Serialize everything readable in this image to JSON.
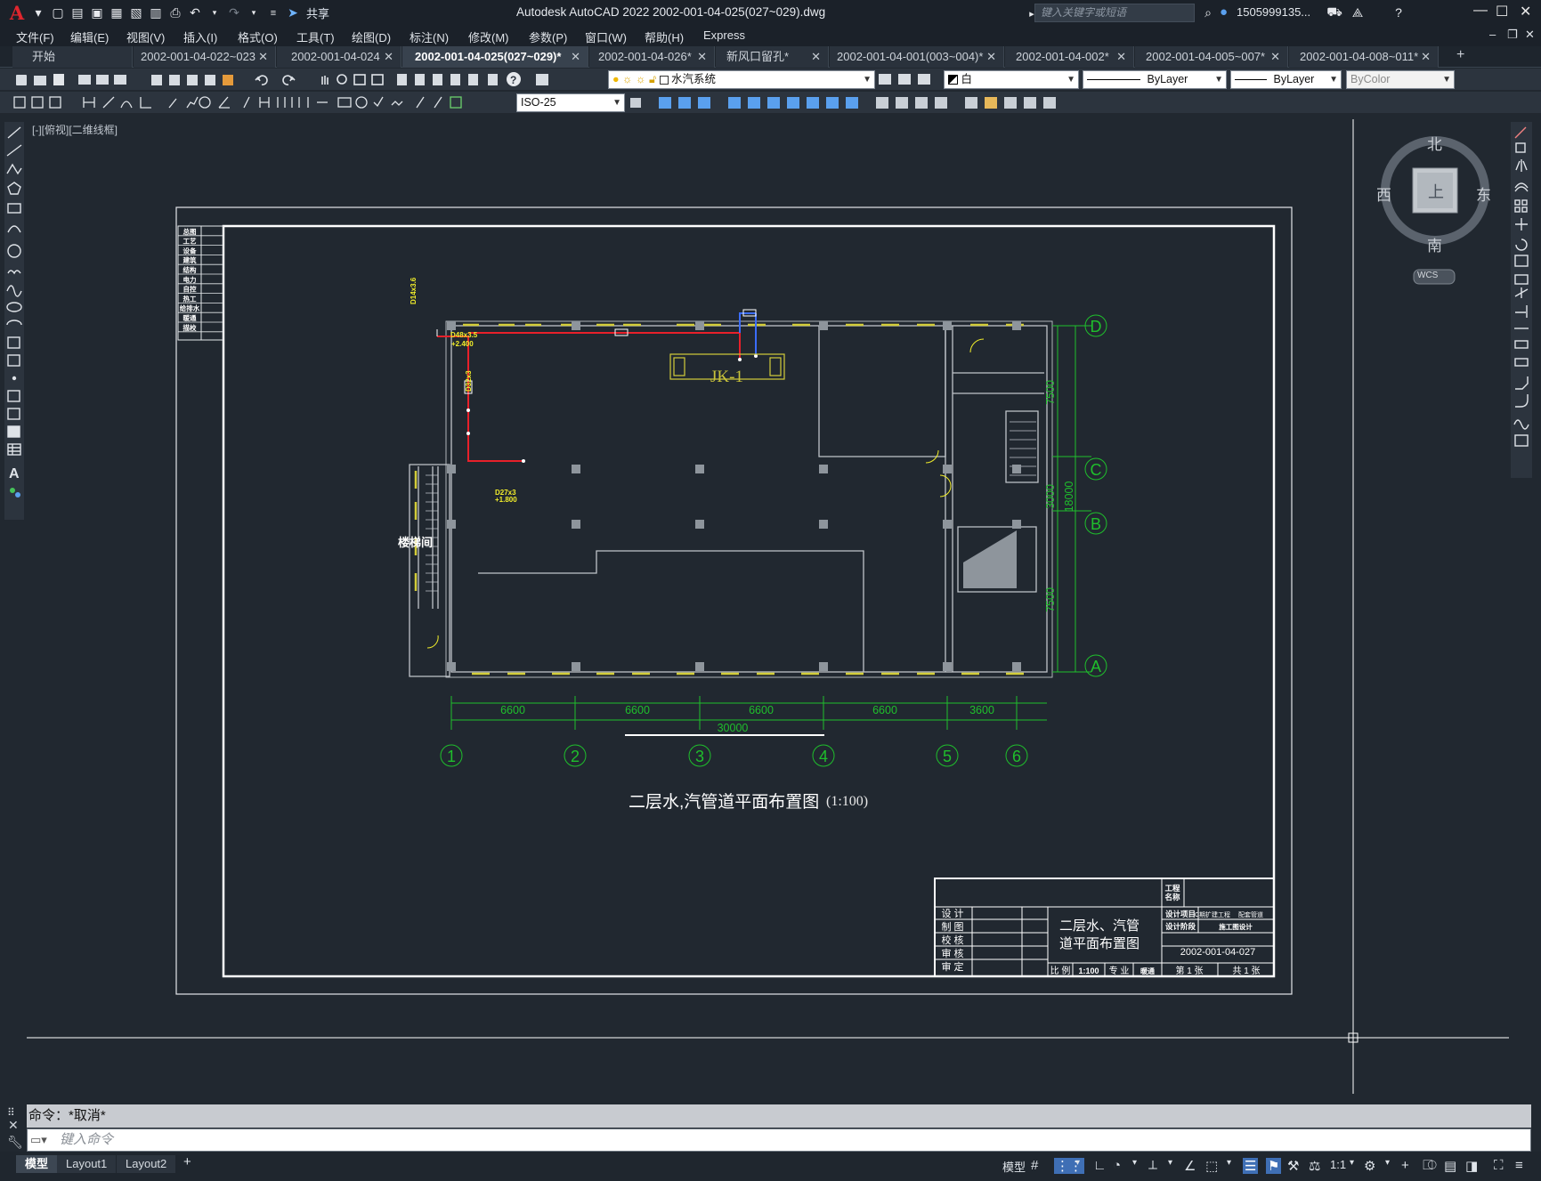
{
  "window": {
    "title": "Autodesk AutoCAD 2022    2002-001-04-025(027~029).dwg",
    "share_label": "共享",
    "search_placeholder": "键入关键字或短语",
    "user": "1505999135...",
    "minimize": "—",
    "maximize": "☐",
    "close": "✕"
  },
  "menu": [
    "文件(F)",
    "编辑(E)",
    "视图(V)",
    "插入(I)",
    "格式(O)",
    "工具(T)",
    "绘图(D)",
    "标注(N)",
    "修改(M)",
    "参数(P)",
    "窗口(W)",
    "帮助(H)",
    "Express"
  ],
  "file_tabs": [
    {
      "label": "开始",
      "active": false,
      "closable": false
    },
    {
      "label": "2002-001-04-022~023",
      "active": false,
      "closable": true
    },
    {
      "label": "2002-001-04-024",
      "active": false,
      "closable": true
    },
    {
      "label": "2002-001-04-025(027~029)*",
      "active": true,
      "closable": true
    },
    {
      "label": "2002-001-04-026*",
      "active": false,
      "closable": true
    },
    {
      "label": "新风口留孔*",
      "active": false,
      "closable": true
    },
    {
      "label": "2002-001-04-001(003~004)*",
      "active": false,
      "closable": true
    },
    {
      "label": "2002-001-04-002*",
      "active": false,
      "closable": true
    },
    {
      "label": "2002-001-04-005~007*",
      "active": false,
      "closable": true
    },
    {
      "label": "2002-001-04-008~011*",
      "active": false,
      "closable": true
    }
  ],
  "toolbar": {
    "layer": "水汽系统",
    "color": "白",
    "linetype": "ByLayer",
    "lineweight": "ByLayer",
    "plotstyle": "ByColor",
    "dimstyle": "ISO-25"
  },
  "viewport_label": "[-][俯视][二维线框]",
  "viewcube": {
    "north": "北",
    "south": "南",
    "east": "东",
    "west": "西",
    "face": "上",
    "wcs": "WCS"
  },
  "drawing": {
    "title": "二层水,汽管道平面布置图",
    "scale": "(1:100)",
    "equipment_label": "JK-1",
    "stair_label": "楼梯间",
    "dims_bottom": [
      "6600",
      "6600",
      "6600",
      "6600",
      "3600"
    ],
    "dim_total_bottom": "30000",
    "dims_right": [
      "7500",
      "3000",
      "7500"
    ],
    "dim_total_right": "18000",
    "axes_bottom": [
      "1",
      "2",
      "3",
      "4",
      "5",
      "6"
    ],
    "axes_right": [
      "D",
      "C",
      "B",
      "A"
    ],
    "pipe_labels": [
      "D14x3.6",
      "D48x3.5",
      "+2.400",
      "D32x3",
      "D27x3",
      "+1.800"
    ],
    "stamp_rows": [
      "总图",
      "工艺",
      "设备",
      "建筑",
      "结构",
      "电力",
      "自控",
      "热工",
      "给排水",
      "暖通",
      "描校"
    ],
    "title_block": {
      "left_rows": [
        "设 计",
        "制 图",
        "校 核",
        "审 核",
        "审 定"
      ],
      "drawing_name_1": "二层水、汽管",
      "drawing_name_2": "道平面布置图",
      "project_label": "工程名称",
      "design_item_label": "设计项目",
      "design_item_value_1": "C期扩建工程",
      "design_item_value_2": "配套管道",
      "design_stage_label": "设计阶段",
      "design_stage_value": "施工图设计",
      "drawing_number": "2002-001-04-027",
      "scale_label": "比 例",
      "scale_value": "1:100",
      "specialty_label": "专 业",
      "specialty_value": "暖通",
      "sheet_label": "第 1 张",
      "total_label": "共 1 张"
    }
  },
  "command": {
    "history": "命令：*取消*",
    "placeholder": "键入命令"
  },
  "layout_tabs": [
    "模型",
    "Layout1",
    "Layout2"
  ],
  "status": {
    "model": "模型",
    "scale": "1:1"
  },
  "colors": {
    "accent_red": "#e0262e",
    "pipe_red": "#e8202a",
    "dim_green": "#1fbf2c",
    "label_yellow": "#f3ef2a",
    "wall_gray": "#bfc4c9",
    "column_gray": "#8e959c"
  }
}
